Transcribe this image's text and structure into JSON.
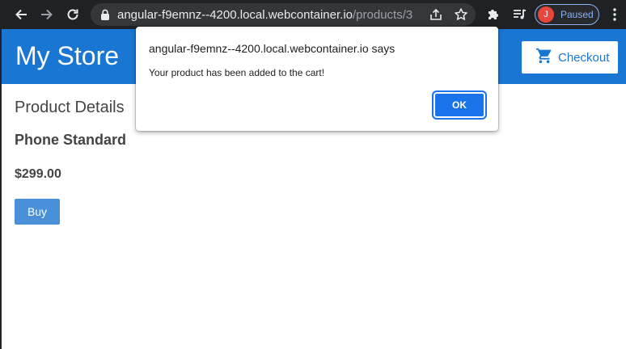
{
  "browser": {
    "url_host": "angular-f9emnz--4200.local.webcontainer.io",
    "url_path": "/products/3",
    "profile_initial": "J",
    "profile_status": "Paused"
  },
  "header": {
    "title": "My Store",
    "checkout_label": "Checkout"
  },
  "product": {
    "section_title": "Product Details",
    "name": "Phone Standard",
    "price": "$299.00",
    "buy_label": "Buy"
  },
  "dialog": {
    "title": "angular-f9emnz--4200.local.webcontainer.io says",
    "message": "Your product has been added to the cart!",
    "ok_label": "OK"
  },
  "colors": {
    "header_bg": "#1976d2",
    "buy_button": "#4a90d9",
    "dialog_ok": "#1a73e8",
    "chrome_bg": "#202124"
  },
  "icons": [
    "back-arrow-icon",
    "forward-arrow-icon",
    "reload-icon",
    "lock-icon",
    "share-icon",
    "bookmark-star-icon",
    "extensions-puzzle-icon",
    "media-queue-icon",
    "more-kebab-icon",
    "shopping-cart-icon"
  ]
}
